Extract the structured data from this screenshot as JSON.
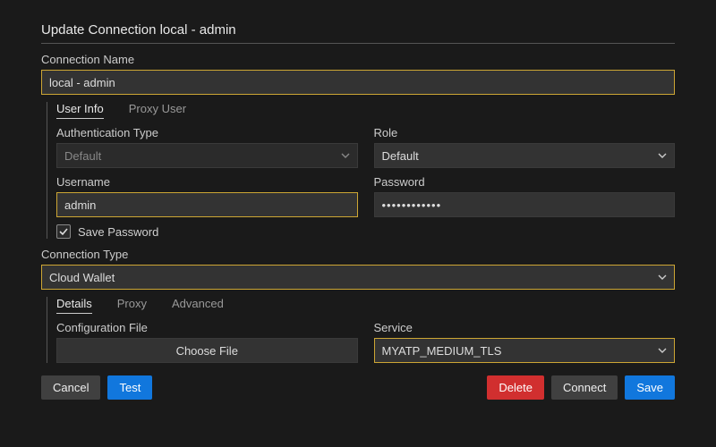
{
  "title": "Update Connection local - admin",
  "connectionName": {
    "label": "Connection Name",
    "value": "local - admin"
  },
  "userInfo": {
    "tabs": [
      {
        "label": "User Info",
        "active": true
      },
      {
        "label": "Proxy User",
        "active": false
      }
    ],
    "authType": {
      "label": "Authentication Type",
      "value": "Default"
    },
    "role": {
      "label": "Role",
      "value": "Default"
    },
    "username": {
      "label": "Username",
      "value": "admin"
    },
    "password": {
      "label": "Password",
      "value": "••••••••••••"
    },
    "savePassword": {
      "label": "Save Password",
      "checked": true
    }
  },
  "connectionType": {
    "label": "Connection Type",
    "value": "Cloud Wallet"
  },
  "details": {
    "tabs": [
      {
        "label": "Details",
        "active": true
      },
      {
        "label": "Proxy",
        "active": false
      },
      {
        "label": "Advanced",
        "active": false
      }
    ],
    "configFile": {
      "label": "Configuration File",
      "button": "Choose File"
    },
    "service": {
      "label": "Service",
      "value": "MYATP_MEDIUM_TLS"
    }
  },
  "buttons": {
    "cancel": "Cancel",
    "test": "Test",
    "delete": "Delete",
    "connect": "Connect",
    "save": "Save"
  }
}
